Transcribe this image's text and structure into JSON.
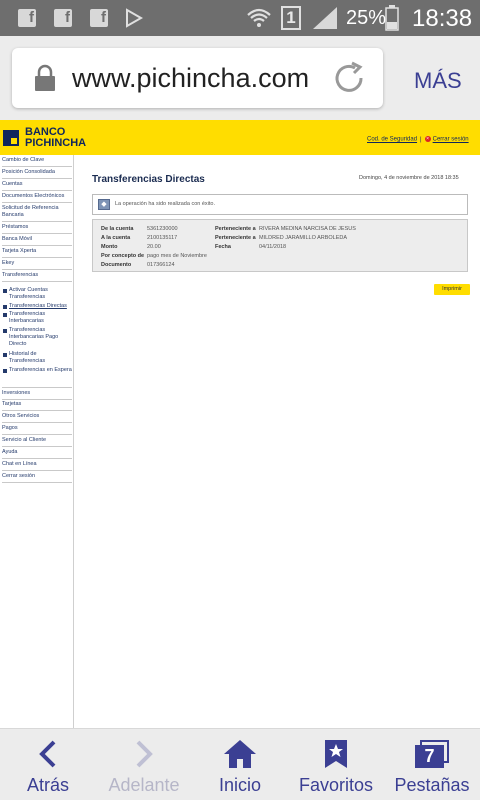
{
  "status_bar": {
    "battery_percent": "25%",
    "time": "18:38",
    "sim_number": "1",
    "icons": [
      "facebook-icon",
      "facebook-icon",
      "facebook-icon",
      "play-store-icon",
      "wifi-icon",
      "signal-icon",
      "battery-icon"
    ]
  },
  "browser": {
    "url": "www.pichincha.com",
    "more_label": "MÁS"
  },
  "site": {
    "logo_line1": "BANCO",
    "logo_line2": "PICHINCHA",
    "security_code_link": "Cod. de Seguridad",
    "separator": "|",
    "close_session_link": "Cerrar sesión"
  },
  "sidebar": {
    "items_top": [
      "Cambio de Clave",
      "Posición Consolidada",
      "Cuentas",
      "Documentos Electrónicos",
      "Solicitud de Referencia Bancaria",
      "Préstamos",
      "Banca Móvil",
      "Tarjeta Xperta",
      "Ekey",
      "Transferencias"
    ],
    "sub_items": [
      "Activar Cuentas Transferencias",
      "Transferencias Directas",
      "Transferencias Interbancarias",
      "Transferencias Interbancarias Pago Directo",
      "Historial de Transferencias",
      "Transferencias en Espera"
    ],
    "items_bottom": [
      "Inversiones",
      "Tarjetas",
      "Otros Servicios",
      "Pagos",
      "Servicio al Cliente",
      "Ayuda",
      "Chat en Línea",
      "Cerrar sesión"
    ]
  },
  "main": {
    "title": "Transferencias Directas",
    "date": "Domingo, 4 de noviembre de 2018 18:35",
    "message": "La operación ha sido realizada con éxito.",
    "details": {
      "from_account_label": "De la cuenta",
      "from_account_value": "5361230000",
      "to_account_label": "A la cuenta",
      "to_account_value": "2100135117",
      "amount_label": "Monto",
      "amount_value": "20.00",
      "concept_label": "Por concepto de",
      "concept_value": "pago mes de Noviembre",
      "document_label": "Documento",
      "document_value": "017366124",
      "owner1_label": "Perteneciente a",
      "owner1_value": "RIVERA MEDINA NARCISA DE JESUS",
      "owner2_label": "Perteneciente a",
      "owner2_value": "MILDRED JARAMILLO ARBOLEDA",
      "date_label": "Fecha",
      "date_value": "04/11/2018"
    },
    "print_button": "Imprimir"
  },
  "toolbar": {
    "back": "Atrás",
    "forward": "Adelante",
    "home": "Inicio",
    "favorites": "Favoritos",
    "tabs": "Pestañas",
    "tabs_count": "7"
  },
  "colors": {
    "brand_yellow": "#ffdd00",
    "brand_navy": "#0f265c",
    "browser_accent": "#3b3f93"
  }
}
